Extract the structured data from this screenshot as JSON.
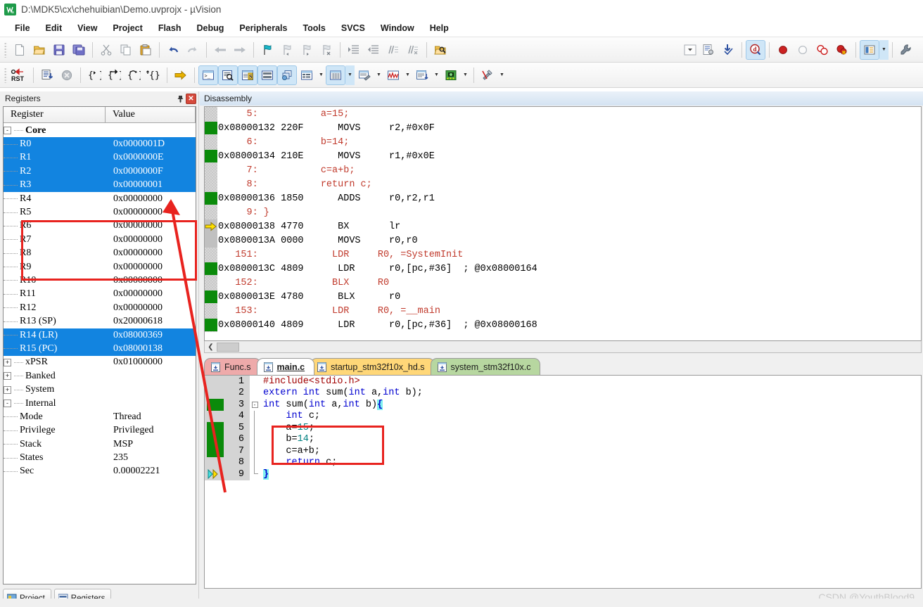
{
  "window": {
    "title": "D:\\MDK5\\cx\\chehuibian\\Demo.uvprojx - µVision",
    "app_icon": "uvision-logo-icon"
  },
  "menu": {
    "items": [
      {
        "label": "File"
      },
      {
        "label": "Edit"
      },
      {
        "label": "View"
      },
      {
        "label": "Project"
      },
      {
        "label": "Flash"
      },
      {
        "label": "Debug"
      },
      {
        "label": "Peripherals"
      },
      {
        "label": "Tools"
      },
      {
        "label": "SVCS"
      },
      {
        "label": "Window"
      },
      {
        "label": "Help"
      }
    ]
  },
  "toolbar_main": {
    "buttons": [
      {
        "name": "new-file-icon"
      },
      {
        "name": "open-file-icon"
      },
      {
        "name": "save-icon"
      },
      {
        "name": "save-all-icon"
      },
      {
        "name": "cut-icon"
      },
      {
        "name": "copy-icon"
      },
      {
        "name": "paste-icon"
      },
      {
        "name": "undo-icon"
      },
      {
        "name": "redo-icon"
      },
      {
        "name": "navigate-back-icon"
      },
      {
        "name": "navigate-forward-icon"
      },
      {
        "name": "bookmark-toggle-icon"
      },
      {
        "name": "bookmark-prev-icon"
      },
      {
        "name": "bookmark-next-icon"
      },
      {
        "name": "bookmark-clear-icon"
      },
      {
        "name": "indent-right-icon"
      },
      {
        "name": "indent-left-icon"
      },
      {
        "name": "comment-lines-icon"
      },
      {
        "name": "uncomment-lines-icon"
      },
      {
        "name": "find-in-files-icon"
      },
      {
        "name": "dropdown-chevron-icon"
      },
      {
        "name": "configure-target-icon"
      },
      {
        "name": "batch-build-icon"
      },
      {
        "name": "start-debug-session-icon"
      },
      {
        "name": "breakpoint-insert-icon"
      },
      {
        "name": "breakpoint-disable-icon"
      },
      {
        "name": "breakpoint-disable-all-icon"
      },
      {
        "name": "breakpoint-kill-all-icon"
      },
      {
        "name": "manage-components-icon"
      },
      {
        "name": "components-dropdown-icon"
      },
      {
        "name": "configure-icon"
      }
    ]
  },
  "toolbar_debug": {
    "buttons": [
      {
        "name": "reset-cpu-icon",
        "label": "RST"
      },
      {
        "name": "run-icon"
      },
      {
        "name": "stop-icon"
      },
      {
        "name": "step-into-icon"
      },
      {
        "name": "step-over-icon"
      },
      {
        "name": "step-out-icon"
      },
      {
        "name": "run-to-cursor-icon"
      },
      {
        "name": "show-next-statement-icon"
      },
      {
        "name": "command-window-icon"
      },
      {
        "name": "disassembly-window-icon"
      },
      {
        "name": "symbols-window-icon"
      },
      {
        "name": "registers-window-icon"
      },
      {
        "name": "call-stack-window-icon"
      },
      {
        "name": "watch-windows-icon"
      },
      {
        "name": "memory-windows-icon"
      },
      {
        "name": "serial-windows-icon"
      },
      {
        "name": "analysis-windows-icon"
      },
      {
        "name": "trace-windows-icon"
      },
      {
        "name": "system-viewer-icon"
      },
      {
        "name": "toolbox-icon"
      }
    ]
  },
  "registers_panel": {
    "title": "Registers",
    "pin_icon": "auto-hide-pin-icon",
    "close_icon": "close-icon",
    "columns": [
      "Register",
      "Value"
    ],
    "rows": [
      {
        "indent": 0,
        "expander": "-",
        "name": "Core",
        "value": "",
        "selected": false,
        "bold": true
      },
      {
        "indent": 2,
        "expander": "",
        "name": "R0",
        "value": "0x0000001D",
        "selected": true
      },
      {
        "indent": 2,
        "expander": "",
        "name": "R1",
        "value": "0x0000000E",
        "selected": true
      },
      {
        "indent": 2,
        "expander": "",
        "name": "R2",
        "value": "0x0000000F",
        "selected": true
      },
      {
        "indent": 2,
        "expander": "",
        "name": "R3",
        "value": "0x00000001",
        "selected": true
      },
      {
        "indent": 2,
        "expander": "",
        "name": "R4",
        "value": "0x00000000",
        "selected": false
      },
      {
        "indent": 2,
        "expander": "",
        "name": "R5",
        "value": "0x00000000",
        "selected": false
      },
      {
        "indent": 2,
        "expander": "",
        "name": "R6",
        "value": "0x00000000",
        "selected": false
      },
      {
        "indent": 2,
        "expander": "",
        "name": "R7",
        "value": "0x00000000",
        "selected": false
      },
      {
        "indent": 2,
        "expander": "",
        "name": "R8",
        "value": "0x00000000",
        "selected": false
      },
      {
        "indent": 2,
        "expander": "",
        "name": "R9",
        "value": "0x00000000",
        "selected": false
      },
      {
        "indent": 2,
        "expander": "",
        "name": "R10",
        "value": "0x00000000",
        "selected": false
      },
      {
        "indent": 2,
        "expander": "",
        "name": "R11",
        "value": "0x00000000",
        "selected": false
      },
      {
        "indent": 2,
        "expander": "",
        "name": "R12",
        "value": "0x00000000",
        "selected": false
      },
      {
        "indent": 2,
        "expander": "",
        "name": "R13 (SP)",
        "value": "0x20000618",
        "selected": false
      },
      {
        "indent": 2,
        "expander": "",
        "name": "R14 (LR)",
        "value": "0x08000369",
        "selected": true
      },
      {
        "indent": 2,
        "expander": "",
        "name": "R15 (PC)",
        "value": "0x08000138",
        "selected": true
      },
      {
        "indent": 1,
        "expander": "+",
        "name": "xPSR",
        "value": "0x01000000",
        "selected": false
      },
      {
        "indent": 0,
        "expander": "+",
        "name": "Banked",
        "value": "",
        "selected": false
      },
      {
        "indent": 0,
        "expander": "+",
        "name": "System",
        "value": "",
        "selected": false
      },
      {
        "indent": 0,
        "expander": "-",
        "name": "Internal",
        "value": "",
        "selected": false
      },
      {
        "indent": 2,
        "expander": "",
        "name": "Mode",
        "value": "Thread",
        "selected": false
      },
      {
        "indent": 2,
        "expander": "",
        "name": "Privilege",
        "value": "Privileged",
        "selected": false
      },
      {
        "indent": 2,
        "expander": "",
        "name": "Stack",
        "value": "MSP",
        "selected": false
      },
      {
        "indent": 2,
        "expander": "",
        "name": "States",
        "value": "235",
        "selected": false
      },
      {
        "indent": 2,
        "expander": "",
        "name": "Sec",
        "value": "0.00002221",
        "selected": false
      }
    ],
    "bottom_tabs": [
      {
        "label": "Project",
        "icon": "project-icon"
      },
      {
        "label": "Registers",
        "icon": "registers-icon"
      }
    ]
  },
  "disassembly": {
    "title": "Disassembly",
    "lines": [
      {
        "marker": "none",
        "text": "     5:           a=15;",
        "kind": "src"
      },
      {
        "marker": "green",
        "text": "0x08000132 220F      MOVS     r2,#0x0F",
        "kind": "asm"
      },
      {
        "marker": "none",
        "text": "     6:           b=14;",
        "kind": "src"
      },
      {
        "marker": "green",
        "text": "0x08000134 210E      MOVS     r1,#0x0E",
        "kind": "asm"
      },
      {
        "marker": "none",
        "text": "     7:           c=a+b;",
        "kind": "src"
      },
      {
        "marker": "none",
        "text": "     8:           return c;",
        "kind": "src"
      },
      {
        "marker": "green",
        "text": "0x08000136 1850      ADDS     r0,r2,r1",
        "kind": "asm"
      },
      {
        "marker": "none",
        "text": "     9: }",
        "kind": "src"
      },
      {
        "marker": "pc",
        "text": "0x08000138 4770      BX       lr",
        "kind": "asm"
      },
      {
        "marker": "plain",
        "text": "0x0800013A 0000      MOVS     r0,r0",
        "kind": "asm"
      },
      {
        "marker": "none",
        "text": "   151:             LDR     R0, =SystemInit",
        "kind": "src"
      },
      {
        "marker": "green",
        "text": "0x0800013C 4809      LDR      r0,[pc,#36]  ; @0x08000164",
        "kind": "asm"
      },
      {
        "marker": "none",
        "text": "   152:             BLX     R0",
        "kind": "src"
      },
      {
        "marker": "green",
        "text": "0x0800013E 4780      BLX      r0",
        "kind": "asm"
      },
      {
        "marker": "none",
        "text": "   153:             LDR     R0, =__main",
        "kind": "src"
      },
      {
        "marker": "green",
        "text": "0x08000140 4809      LDR      r0,[pc,#36]  ; @0x08000168",
        "kind": "asm"
      }
    ],
    "scrollbar": {
      "left_arrow": "chevron-left-icon"
    }
  },
  "file_tabs": [
    {
      "label": "Func.s",
      "color": "#eeaaaa",
      "active": false,
      "icon": "source-file-icon"
    },
    {
      "label": "main.c",
      "color": "#ffffff",
      "active": true,
      "icon": "source-file-icon"
    },
    {
      "label": "startup_stm32f10x_hd.s",
      "color": "#ffd778",
      "active": false,
      "icon": "source-file-icon"
    },
    {
      "label": "system_stm32f10x.c",
      "color": "#b7d7a0",
      "active": false,
      "icon": "source-file-icon"
    }
  ],
  "editor": {
    "lines": [
      {
        "num": "1",
        "marker": "none",
        "fold": "none",
        "segments": [
          {
            "t": "#include<stdio.h>",
            "c": "pre"
          }
        ]
      },
      {
        "num": "2",
        "marker": "none",
        "fold": "none",
        "segments": [
          {
            "t": "extern ",
            "c": "kw"
          },
          {
            "t": "int",
            "c": "kw"
          },
          {
            "t": " sum(",
            "c": "plain"
          },
          {
            "t": "int",
            "c": "kw"
          },
          {
            "t": " a,",
            "c": "plain"
          },
          {
            "t": "int",
            "c": "kw"
          },
          {
            "t": " b);",
            "c": "plain"
          }
        ]
      },
      {
        "num": "3",
        "marker": "green",
        "fold": "start",
        "segments": [
          {
            "t": "int",
            "c": "kw"
          },
          {
            "t": " sum(",
            "c": "plain"
          },
          {
            "t": "int",
            "c": "kw"
          },
          {
            "t": " a,",
            "c": "plain"
          },
          {
            "t": "int",
            "c": "kw"
          },
          {
            "t": " b)",
            "c": "plain"
          },
          {
            "t": "{",
            "c": "brace"
          }
        ]
      },
      {
        "num": "4",
        "marker": "none",
        "fold": "line",
        "segments": [
          {
            "t": "    ",
            "c": "plain"
          },
          {
            "t": "int",
            "c": "kw"
          },
          {
            "t": " c;",
            "c": "plain"
          }
        ]
      },
      {
        "num": "5",
        "marker": "green",
        "fold": "line",
        "segments": [
          {
            "t": "    a=",
            "c": "plain"
          },
          {
            "t": "15",
            "c": "num"
          },
          {
            "t": ";",
            "c": "plain"
          }
        ]
      },
      {
        "num": "6",
        "marker": "green",
        "fold": "line",
        "segments": [
          {
            "t": "    b=",
            "c": "plain"
          },
          {
            "t": "14",
            "c": "num"
          },
          {
            "t": ";",
            "c": "plain"
          }
        ]
      },
      {
        "num": "7",
        "marker": "green",
        "fold": "line",
        "segments": [
          {
            "t": "    c=a+b;",
            "c": "plain"
          }
        ]
      },
      {
        "num": "8",
        "marker": "none",
        "fold": "line",
        "segments": [
          {
            "t": "    ",
            "c": "plain"
          },
          {
            "t": "return",
            "c": "kw"
          },
          {
            "t": " c;",
            "c": "plain"
          }
        ]
      },
      {
        "num": "9",
        "marker": "pc",
        "fold": "end",
        "segments": [
          {
            "t": "}",
            "c": "brace"
          }
        ]
      }
    ]
  },
  "annotations": {
    "register_highlight_box": "red-highlight-rectangle",
    "code_highlight_box": "red-highlight-rectangle",
    "arrow": "red-arrow-annotation"
  },
  "watermark": {
    "text": "CSDN @YouthBlood9"
  },
  "colors": {
    "selection_blue": "#1284e0",
    "annotation_red": "#e8231f",
    "breakpoint_green": "#0a8a0a",
    "pc_yellow": "#ffe000",
    "source_line_red": "#c0392b"
  }
}
